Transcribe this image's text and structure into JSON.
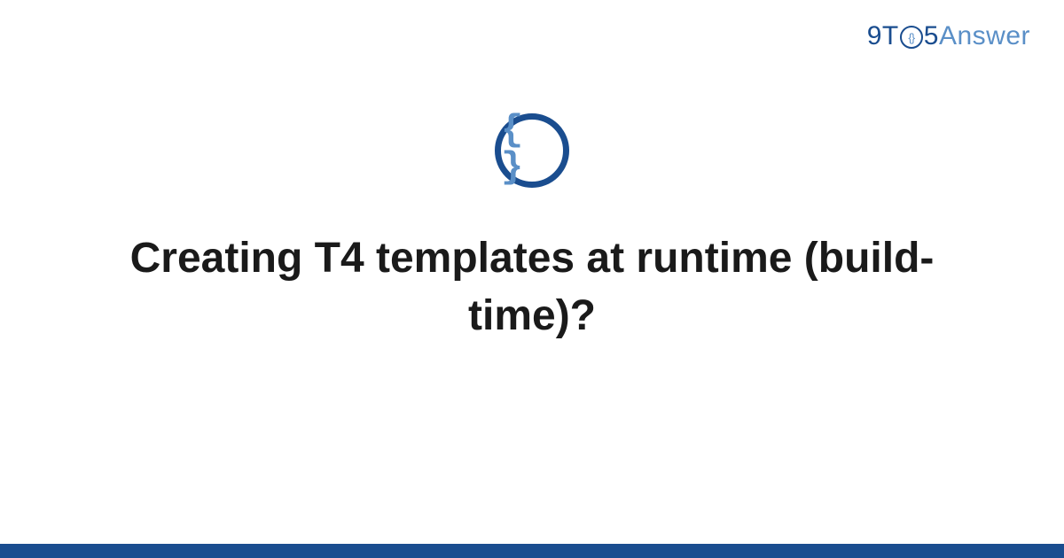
{
  "logo": {
    "part1": "9T",
    "circle_inner": "{}",
    "part2": "5",
    "part3": "Answer"
  },
  "icon": {
    "name": "code-braces-icon",
    "glyph": "{ }"
  },
  "title": "Creating T4 templates at runtime (build-time)?",
  "colors": {
    "primary": "#1a4d8f",
    "secondary": "#5a8fc7"
  }
}
